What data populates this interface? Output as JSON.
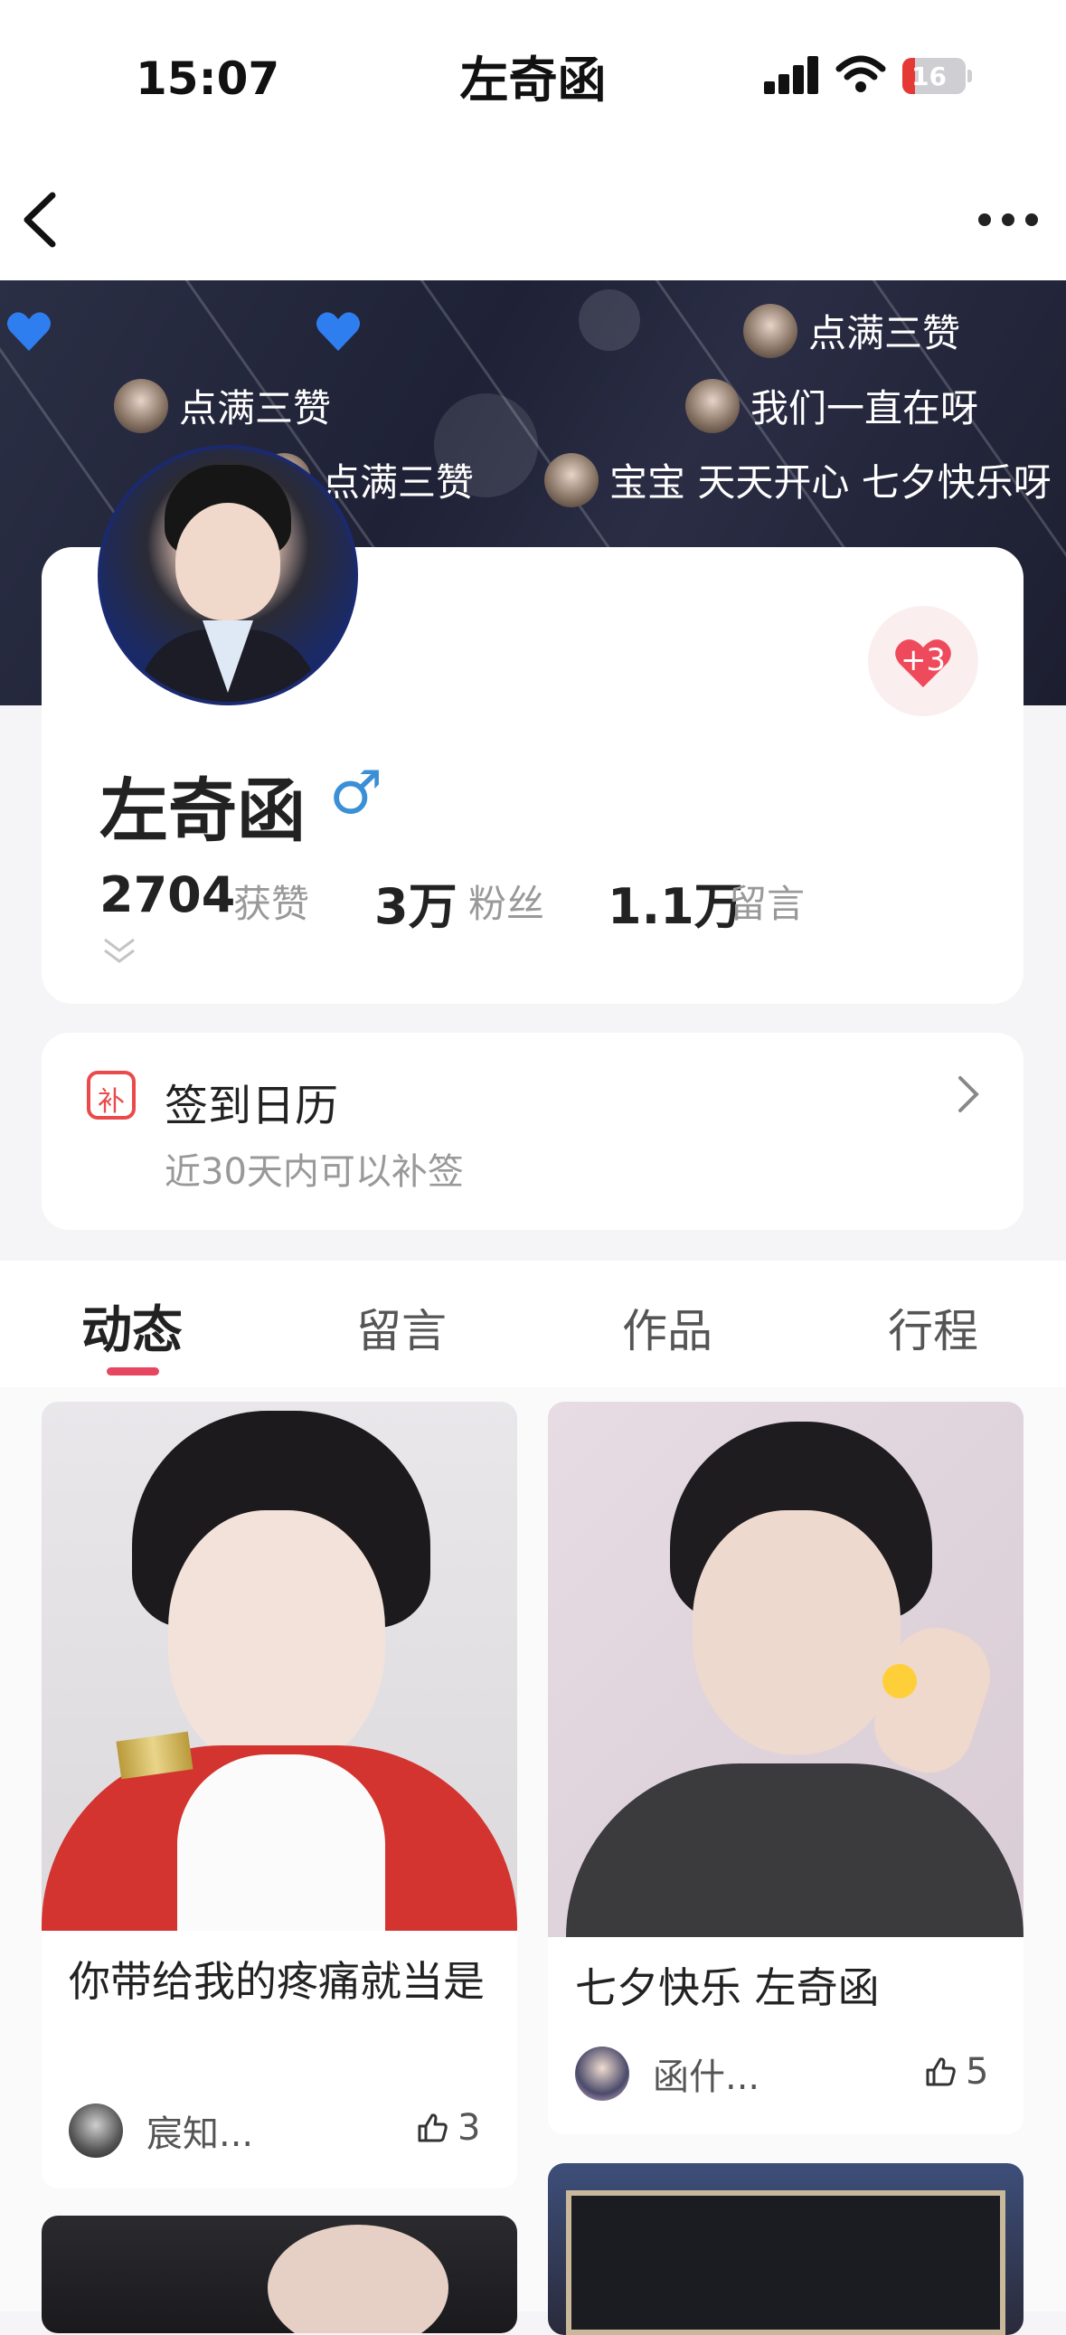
{
  "status_bar": {
    "time": "15:07",
    "battery": "16"
  },
  "nav": {
    "title": "左奇函"
  },
  "banner": {
    "danmu": [
      "点满三赞",
      "点满三赞",
      "我们一直在呀",
      "点满三赞",
      "宝宝 天天开心 七夕快乐呀"
    ]
  },
  "profile": {
    "name": "左奇函",
    "gender_symbol": "♂",
    "like_badge": "+3",
    "stats": [
      {
        "value": "2704",
        "label": "获赞"
      },
      {
        "value": "3万",
        "label": "粉丝"
      },
      {
        "value": "1.1万",
        "label": "留言"
      }
    ]
  },
  "calendar": {
    "icon_char": "补",
    "title": "签到日历",
    "subtitle": "近30天内可以补签"
  },
  "tabs": [
    "动态",
    "留言",
    "作品",
    "行程"
  ],
  "feed": {
    "left": {
      "title": "你带给我的疼痛就当是",
      "author": "宸知...",
      "likes": "3"
    },
    "right": {
      "title": "七夕快乐 左奇函",
      "author": "函什...",
      "likes": "5"
    }
  },
  "colors": {
    "accent": "#e64660",
    "gender_blue": "#3a8fd6",
    "banner_bg": "#22253a"
  }
}
